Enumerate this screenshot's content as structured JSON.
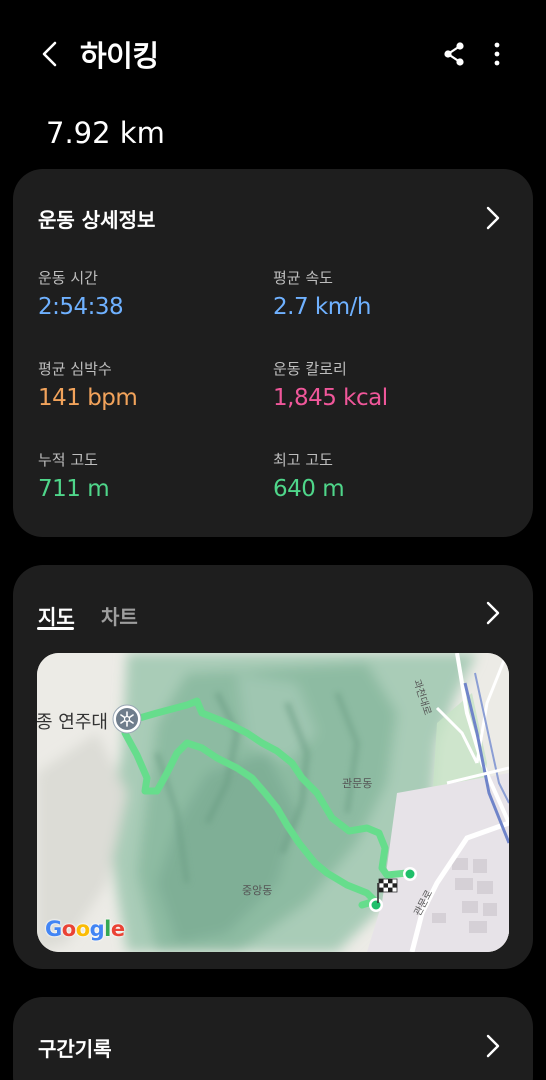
{
  "header": {
    "title": "하이킹",
    "back_icon": "chevron-left-icon",
    "share_icon": "share-icon",
    "more_icon": "more-vertical-icon"
  },
  "summary": {
    "distance": "7.92 km"
  },
  "details": {
    "title": "운동 상세정보",
    "stats": [
      {
        "label": "운동 시간",
        "value": "2:54:38",
        "color": "#6fb1ff"
      },
      {
        "label": "평균 속도",
        "value": "2.7 km/h",
        "color": "#6fb1ff"
      },
      {
        "label": "평균 심박수",
        "value": "141 bpm",
        "color": "#f2a35b"
      },
      {
        "label": "운동 칼로리",
        "value": "1,845 kcal",
        "color": "#f0579a"
      },
      {
        "label": "누적 고도",
        "value": "711 m",
        "color": "#4fd68a"
      },
      {
        "label": "최고 고도",
        "value": "640 m",
        "color": "#4fd68a"
      }
    ]
  },
  "map_section": {
    "tabs": [
      "지도",
      "차트"
    ],
    "active_tab": "지도",
    "place_name": "종 연주대",
    "labels": {
      "gwanmun": "관문동",
      "jungang": "중앙동",
      "gwacheon_road": "과천대로",
      "gwanmun_road": "관문로"
    },
    "logo": "Google",
    "route_color": "#66dd8c"
  },
  "laps": {
    "title": "구간기록"
  }
}
